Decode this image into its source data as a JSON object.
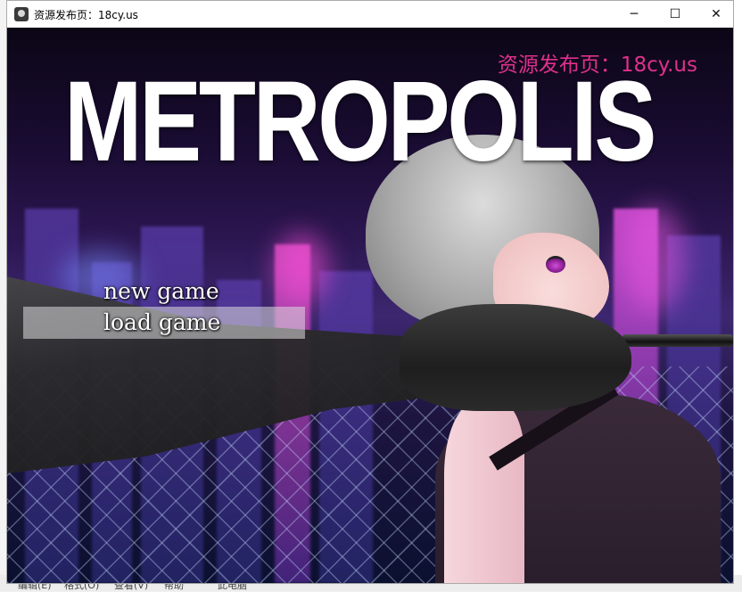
{
  "window": {
    "title": "资源发布页：18cy.us",
    "minimize_glyph": "─",
    "maximize_glyph": "☐",
    "close_glyph": "✕"
  },
  "game": {
    "logo": "METROPOLIS",
    "watermark": "资源发布页：18cy.us",
    "menu": [
      {
        "label": "new game",
        "selected": false
      },
      {
        "label": "load game",
        "selected": true
      }
    ]
  },
  "desktop": {
    "bottom_items": [
      "编辑(E)",
      "格式(O)",
      "查看(V)",
      "帮助",
      "此电脑"
    ]
  },
  "colors": {
    "watermark": "#e0308c",
    "logo": "#ffffff",
    "menu_highlight": "rgba(220,220,220,0.55)"
  }
}
